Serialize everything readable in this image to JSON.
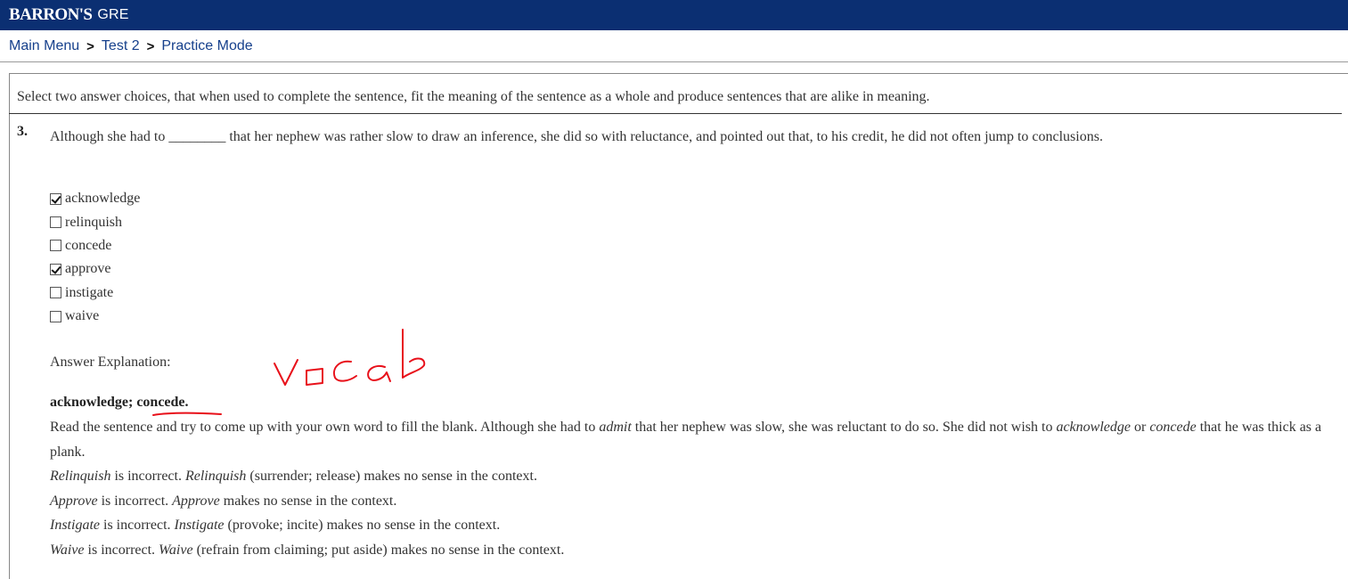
{
  "header": {
    "brand": "BARRON'S",
    "product": "GRE",
    "bg_color": "#0b2f72"
  },
  "breadcrumb": {
    "items": [
      "Main Menu",
      "Test 2",
      "Practice Mode"
    ],
    "separator": ">"
  },
  "question": {
    "instructions": "Select two answer choices, that when used to complete the sentence, fit the meaning of the sentence as a whole and produce sentences that are alike in meaning.",
    "number": "3.",
    "text": "Although she had to ________ that her nephew was rather slow to draw an inference, she did so with reluctance, and pointed out that, to his credit, he did not often jump to conclusions.",
    "choices": [
      {
        "label": "acknowledge",
        "checked": true
      },
      {
        "label": "relinquish",
        "checked": false
      },
      {
        "label": "concede",
        "checked": false
      },
      {
        "label": "approve",
        "checked": true
      },
      {
        "label": "instigate",
        "checked": false
      },
      {
        "label": "waive",
        "checked": false
      }
    ]
  },
  "explanation": {
    "label": "Answer Explanation:",
    "answer": "acknowledge; concede.",
    "p1": {
      "a": "Read the sentence and try to come up with your own word to fill the blank. Although she had to ",
      "b": "admit",
      "c": " that her nephew was slow, she was reluctant to do so. She did not wish to ",
      "d": "acknowledge",
      "e": " or ",
      "f": "concede",
      "g": " that he was thick as a plank."
    },
    "lines": [
      {
        "word": "Relinquish",
        "mid": " is incorrect. ",
        "word2": "Relinquish",
        "rest": " (surrender; release) makes no sense in the context."
      },
      {
        "word": "Approve",
        "mid": " is incorrect. ",
        "word2": "Approve",
        "rest": " makes no sense in the context."
      },
      {
        "word": "Instigate",
        "mid": " is incorrect. ",
        "word2": "Instigate",
        "rest": " (provoke; incite) makes no sense in the context."
      },
      {
        "word": "Waive",
        "mid": " is incorrect. ",
        "word2": "Waive",
        "rest": " (refrain from claiming; put aside) makes no sense in the context."
      }
    ]
  },
  "annotation": {
    "handwriting": "vocab",
    "ink_color": "#e8101a"
  }
}
